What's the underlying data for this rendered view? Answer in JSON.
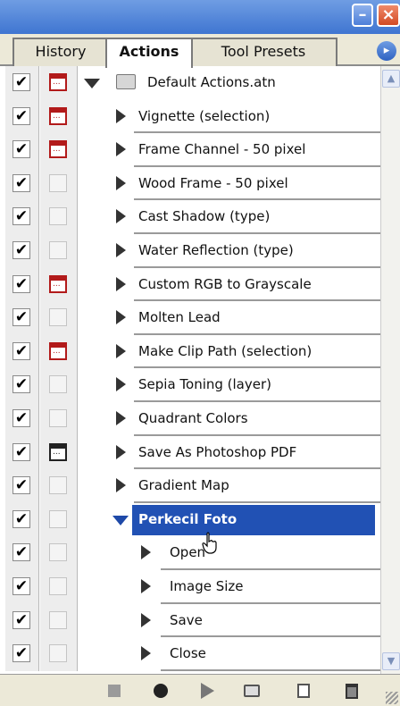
{
  "window": {
    "minimize_glyph": "–",
    "close_glyph": "×"
  },
  "tabs": [
    {
      "label": "History"
    },
    {
      "label": "Actions"
    },
    {
      "label": "Tool Presets"
    }
  ],
  "panel_menu_glyph": "▸",
  "actions": [
    {
      "label": "Default Actions.atn",
      "checked": true,
      "dialog": "red",
      "kind": "set",
      "expanded": true
    },
    {
      "label": "Vignette (selection)",
      "checked": true,
      "dialog": "red",
      "kind": "action"
    },
    {
      "label": "Frame Channel - 50 pixel",
      "checked": true,
      "dialog": "red",
      "kind": "action"
    },
    {
      "label": "Wood Frame - 50 pixel",
      "checked": true,
      "dialog": "none",
      "kind": "action"
    },
    {
      "label": "Cast Shadow (type)",
      "checked": true,
      "dialog": "none",
      "kind": "action"
    },
    {
      "label": "Water Reflection (type)",
      "checked": true,
      "dialog": "none",
      "kind": "action"
    },
    {
      "label": "Custom RGB to Grayscale",
      "checked": true,
      "dialog": "red",
      "kind": "action"
    },
    {
      "label": "Molten Lead",
      "checked": true,
      "dialog": "none",
      "kind": "action"
    },
    {
      "label": "Make Clip Path (selection)",
      "checked": true,
      "dialog": "red",
      "kind": "action"
    },
    {
      "label": "Sepia Toning (layer)",
      "checked": true,
      "dialog": "none",
      "kind": "action"
    },
    {
      "label": "Quadrant Colors",
      "checked": true,
      "dialog": "none",
      "kind": "action"
    },
    {
      "label": "Save As Photoshop PDF",
      "checked": true,
      "dialog": "black",
      "kind": "action"
    },
    {
      "label": "Gradient Map",
      "checked": true,
      "dialog": "none",
      "kind": "action"
    },
    {
      "label": "Perkecil Foto",
      "checked": true,
      "dialog": "none",
      "kind": "action",
      "expanded": true,
      "selected": true
    },
    {
      "label": "Open",
      "checked": true,
      "dialog": "none",
      "kind": "step"
    },
    {
      "label": "Image Size",
      "checked": true,
      "dialog": "none",
      "kind": "step"
    },
    {
      "label": "Save",
      "checked": true,
      "dialog": "none",
      "kind": "step"
    },
    {
      "label": "Close",
      "checked": true,
      "dialog": "none",
      "kind": "step"
    }
  ],
  "check_glyph": "✔",
  "toolbar": {
    "buttons": [
      "stop",
      "record",
      "play",
      "new-set",
      "new-action",
      "delete"
    ]
  }
}
